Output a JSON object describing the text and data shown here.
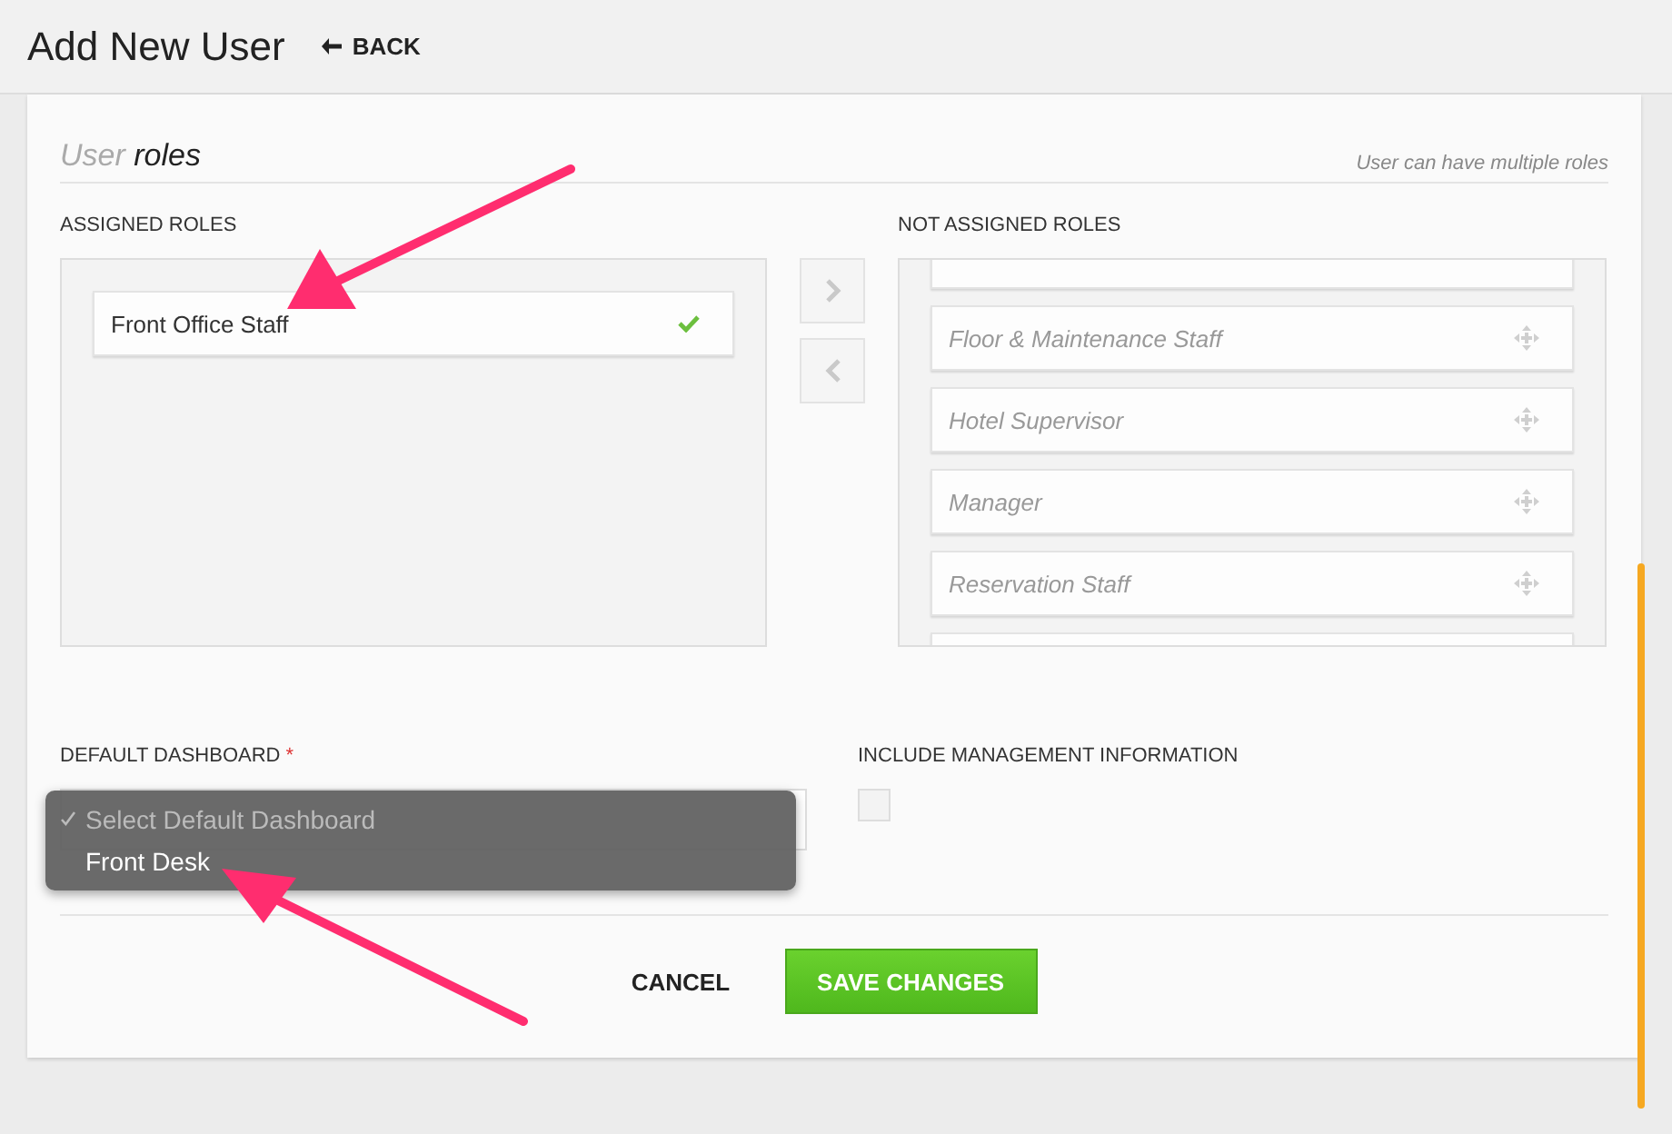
{
  "header": {
    "title": "Add New User",
    "back": "BACK"
  },
  "section": {
    "title_light": "User",
    "title_bold": "roles",
    "hint": "User can have multiple roles"
  },
  "assigned": {
    "label": "ASSIGNED ROLES",
    "items": [
      {
        "name": "Front Office Staff",
        "checked": true
      }
    ]
  },
  "transfer_buttons": [
    {
      "kind": "right",
      "disabled": true
    },
    {
      "kind": "left",
      "disabled": true
    }
  ],
  "not_assigned": {
    "label": "NOT ASSIGNED ROLES",
    "items": [
      "Floor & Maintenance Staff",
      "Hotel Supervisor",
      "Manager",
      "Reservation Staff"
    ]
  },
  "dashboard": {
    "label": "DEFAULT DASHBOARD",
    "required_mark": "*",
    "options": [
      {
        "label": "Select Default Dashboard",
        "selected": true
      },
      {
        "label": "Front Desk",
        "selected": false
      }
    ]
  },
  "management": {
    "label": "INCLUDE MANAGEMENT INFORMATION",
    "checked": false
  },
  "buttons": [
    {
      "label": "CANCEL",
      "kind": "link"
    },
    {
      "label": "SAVE CHANGES",
      "kind": "primary"
    }
  ]
}
